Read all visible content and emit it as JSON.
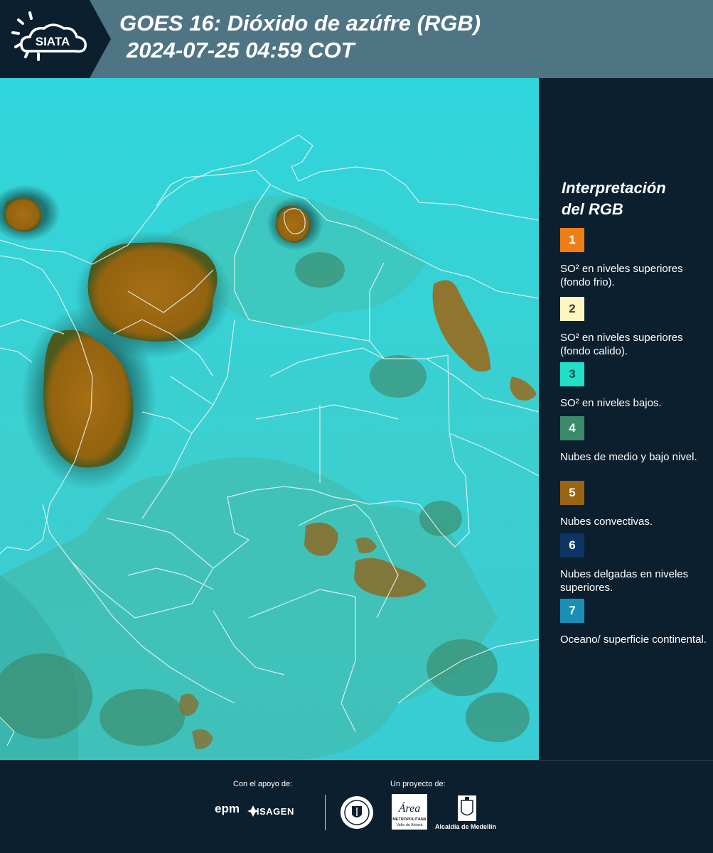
{
  "header": {
    "logo_text": "SIATA",
    "title_line1": "GOES 16: Dióxido de azúfre (RGB)",
    "title_line2": "2024-07-25 04:59 COT"
  },
  "legend": {
    "title_line1": "Interpretación",
    "title_line2": "del RGB",
    "items": [
      {
        "number": "1",
        "color": "#f07e16",
        "text_color": "#ffffff",
        "label": "SO² en niveles superiores (fondo frio)."
      },
      {
        "number": "2",
        "color": "#fdf6c0",
        "text_color": "#3a3a3a",
        "label": "SO² en niveles superiores (fondo calido)."
      },
      {
        "number": "3",
        "color": "#22e0c7",
        "text_color": "#1b4a44",
        "label": "SO² en niveles bajos."
      },
      {
        "number": "4",
        "color": "#3c8a6a",
        "text_color": "#ffffff",
        "label": "Nubes de medio y bajo nivel."
      },
      {
        "number": "5",
        "color": "#9a6512",
        "text_color": "#ffffff",
        "label": "Nubes convectivas."
      },
      {
        "number": "6",
        "color": "#0d3564",
        "text_color": "#ffffff",
        "label": "Nubes delgadas en niveles superiores."
      },
      {
        "number": "7",
        "color": "#1a8fb6",
        "text_color": "#ffffff",
        "label": "Oceano/ superficie continental."
      }
    ]
  },
  "footer": {
    "support_label": "Con el apoyo de:",
    "project_label": "Un proyecto de:",
    "epm": "epm",
    "isagen": "ISAGEN",
    "metro_word": "Área",
    "metro_sub1": "METROPOLITANA",
    "metro_sub2": "Valle de Aburrá",
    "alcaldia": "Alcaldía de Medellín"
  },
  "colors": {
    "header_bg": "#4f7585",
    "panel_bg": "#0c1f2e",
    "map_base": "#2fd2d6",
    "convective": "#9a6512",
    "mid_low_cloud": "#3c8a6a"
  }
}
